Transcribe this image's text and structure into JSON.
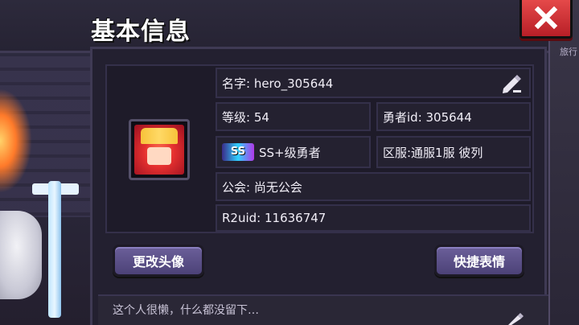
{
  "window": {
    "title": "基本信息",
    "close_label": "✕"
  },
  "side": {
    "label": "旅行"
  },
  "profile": {
    "name_label": "名字: hero_305644",
    "level_label": "等级: 54",
    "hero_id_label": "勇者id: 305644",
    "rank_badge": "SS",
    "rank_label": "SS+级勇者",
    "server_label": "区服:通服1服 彼列",
    "guild_label": "公会: 尚无公会",
    "r2uid_label": "R2uid: 11636747"
  },
  "buttons": {
    "change_avatar": "更改头像",
    "quick_emote": "快捷表情"
  },
  "motto": {
    "text": "这个人很懒，什么都没留下…"
  },
  "colors": {
    "accent": "#5a4f8a",
    "close": "#d4333a",
    "panel": "#232030"
  },
  "icons": [
    "close-icon",
    "edit-icon",
    "avatar-portrait",
    "ss-rank-icon"
  ]
}
